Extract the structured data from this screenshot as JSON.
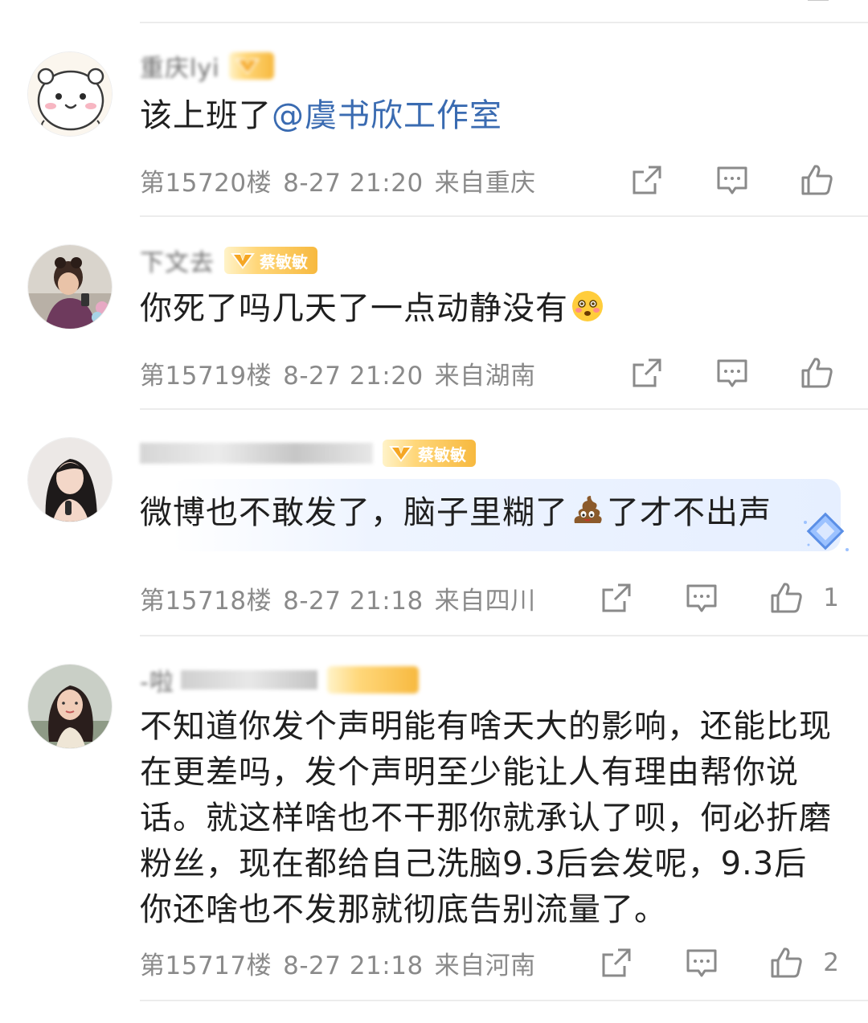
{
  "colors": {
    "mention": "#3a6bb1",
    "meta": "#8a8a8a",
    "badge_gold": "#f7b93f",
    "bubble": "#e6efff",
    "divider": "#ececec"
  },
  "comments": [
    {
      "username": "重庆lyi",
      "badge": "",
      "badge_blurred": true,
      "text": "该上班了",
      "mention": "@虞书欣工作室",
      "floor": "第15720楼",
      "time": "8-27 21:20",
      "location": "来自重庆",
      "likes": "",
      "avatar": "cartoon-hamster-avatar",
      "icons": [
        "share-icon",
        "comment-icon",
        "like-icon"
      ]
    },
    {
      "username": "下文去",
      "badge": "蔡敏敏",
      "badge_blurred": false,
      "text": "你死了吗几天了一点动静没有",
      "emoji": "flushed-face-emoji",
      "floor": "第15719楼",
      "time": "8-27 21:20",
      "location": "来自湖南",
      "likes": "",
      "avatar": "girl-photo-avatar",
      "icons": [
        "share-icon",
        "comment-icon",
        "like-icon"
      ]
    },
    {
      "username": "",
      "badge": "蔡敏敏",
      "badge_blurred": false,
      "text_before": "微博也不敢发了，脑子里糊了",
      "emoji": "poop-emoji",
      "text_after": "了才不出声",
      "floor": "第15718楼",
      "time": "8-27 21:18",
      "location": "来自四川",
      "likes": "1",
      "avatar": "woman-photo-avatar",
      "icons": [
        "share-icon",
        "comment-icon",
        "like-icon"
      ]
    },
    {
      "username": "-啦",
      "badge": "",
      "badge_blurred": true,
      "text": "不知道你发个声明能有啥天大的影响，还能比现在更差吗，发个声明至少能让人有理由帮你说话。就这样啥也不干那你就承认了呗，何必折磨粉丝，现在都给自己洗脑9.3后会发呢，9.3后你还啥也不发那就彻底告别流量了。",
      "floor": "第15717楼",
      "time": "8-27 21:18",
      "location": "来自河南",
      "likes": "2",
      "avatar": "woman-outdoor-avatar",
      "icons": [
        "share-icon",
        "comment-icon",
        "like-icon"
      ]
    }
  ]
}
